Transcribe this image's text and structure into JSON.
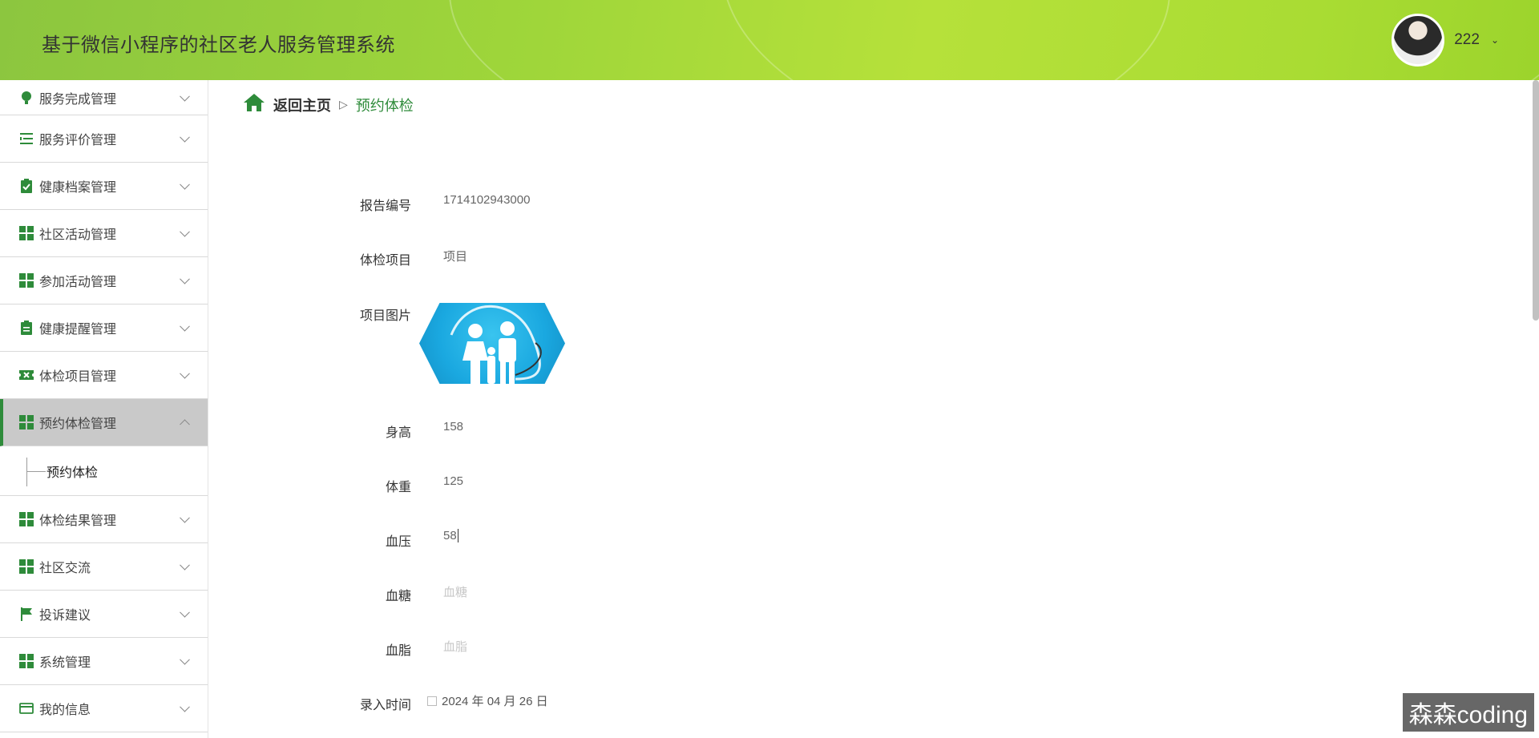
{
  "app": {
    "title": "基于微信小程序的社区老人服务管理系统"
  },
  "user": {
    "name": "222"
  },
  "sidebar": {
    "items": [
      {
        "label": "服务完成管理",
        "icon": "lightbulb-icon"
      },
      {
        "label": "服务评价管理",
        "icon": "list-icon"
      },
      {
        "label": "健康档案管理",
        "icon": "clipboard-check-icon"
      },
      {
        "label": "社区活动管理",
        "icon": "grid-icon"
      },
      {
        "label": "参加活动管理",
        "icon": "grid-icon"
      },
      {
        "label": "健康提醒管理",
        "icon": "clipboard-icon"
      },
      {
        "label": "体检项目管理",
        "icon": "ticket-icon"
      },
      {
        "label": "预约体检管理",
        "icon": "grid-icon",
        "expanded": true
      },
      {
        "label": "体检结果管理",
        "icon": "grid-icon"
      },
      {
        "label": "社区交流",
        "icon": "grid-icon"
      },
      {
        "label": "投诉建议",
        "icon": "flag-icon"
      },
      {
        "label": "系统管理",
        "icon": "grid-icon"
      },
      {
        "label": "我的信息",
        "icon": "card-icon"
      }
    ],
    "submenu": {
      "label": "预约体检"
    }
  },
  "breadcrumb": {
    "home": "返回主页",
    "current": "预约体检"
  },
  "form": {
    "report_no": {
      "label": "报告编号",
      "value": "1714102943000"
    },
    "item": {
      "label": "体检项目",
      "value": "项目"
    },
    "image": {
      "label": "项目图片"
    },
    "height": {
      "label": "身高",
      "value": "158"
    },
    "weight": {
      "label": "体重",
      "value": "125"
    },
    "blood_pressure": {
      "label": "血压",
      "value": "58"
    },
    "blood_sugar": {
      "label": "血糖",
      "placeholder": "血糖"
    },
    "blood_lipid": {
      "label": "血脂",
      "placeholder": "血脂"
    },
    "entry_time": {
      "label": "录入时间",
      "value": "2024 年 04 月 26 日"
    }
  },
  "watermark": "森森coding",
  "colors": {
    "accent": "#2e8b3a",
    "header": "#a6d936"
  }
}
